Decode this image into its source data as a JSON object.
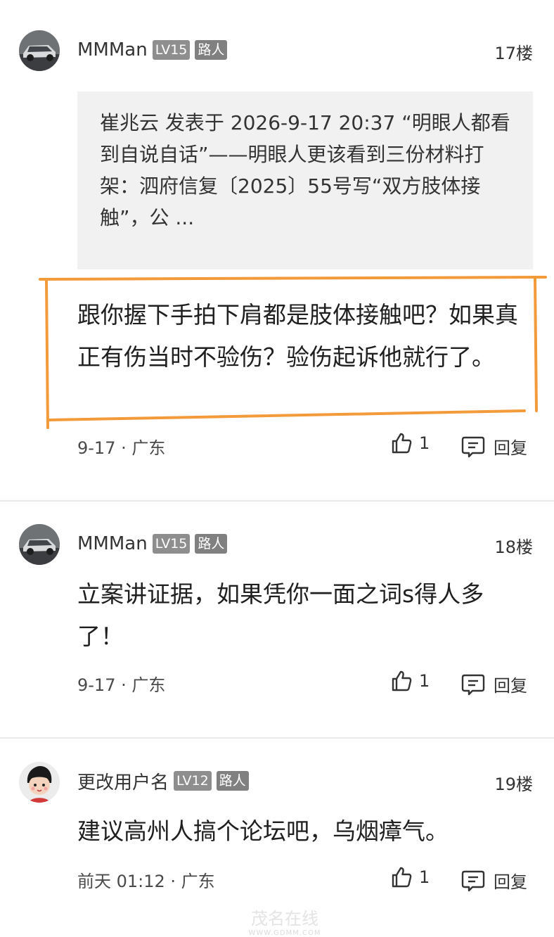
{
  "posts": [
    {
      "username": "MMMan",
      "level": "LV15",
      "role": "路人",
      "floor": "17楼",
      "quote": "崔兆云 发表于 2026-9-17 20:37 “明眼人都看到自说自话”——明眼人更该看到三份材料打架：泗府信复〔2025〕55号写“双方肢体接触”，公 ...",
      "content": "跟你握下手拍下肩都是肢体接触吧？如果真正有伤当时不验伤？验伤起诉他就行了。",
      "meta": "9-17 · 广东",
      "likes": "1",
      "reply_label": "回复"
    },
    {
      "username": "MMMan",
      "level": "LV15",
      "role": "路人",
      "floor": "18楼",
      "content": "立案讲证据，如果凭你一面之词s得人多了！",
      "meta": "9-17 · 广东",
      "likes": "1",
      "reply_label": "回复"
    },
    {
      "username": "更改用户名",
      "level": "LV12",
      "role": "路人",
      "floor": "19楼",
      "content": "建议高州人搞个论坛吧，乌烟瘴气。",
      "meta": "前天 01:12 · 广东",
      "likes": "1",
      "reply_label": "回复"
    }
  ],
  "watermark": {
    "brand": "茂名在线",
    "url": "WWW.GDMM.COM"
  },
  "colors": {
    "highlight": "#f39a3a",
    "badge": "#8e8e8e",
    "quote_bg": "#f1f1f1"
  },
  "icons": [
    "thumbs-up-icon",
    "reply-icon",
    "car-avatar",
    "cartoon-avatar"
  ]
}
